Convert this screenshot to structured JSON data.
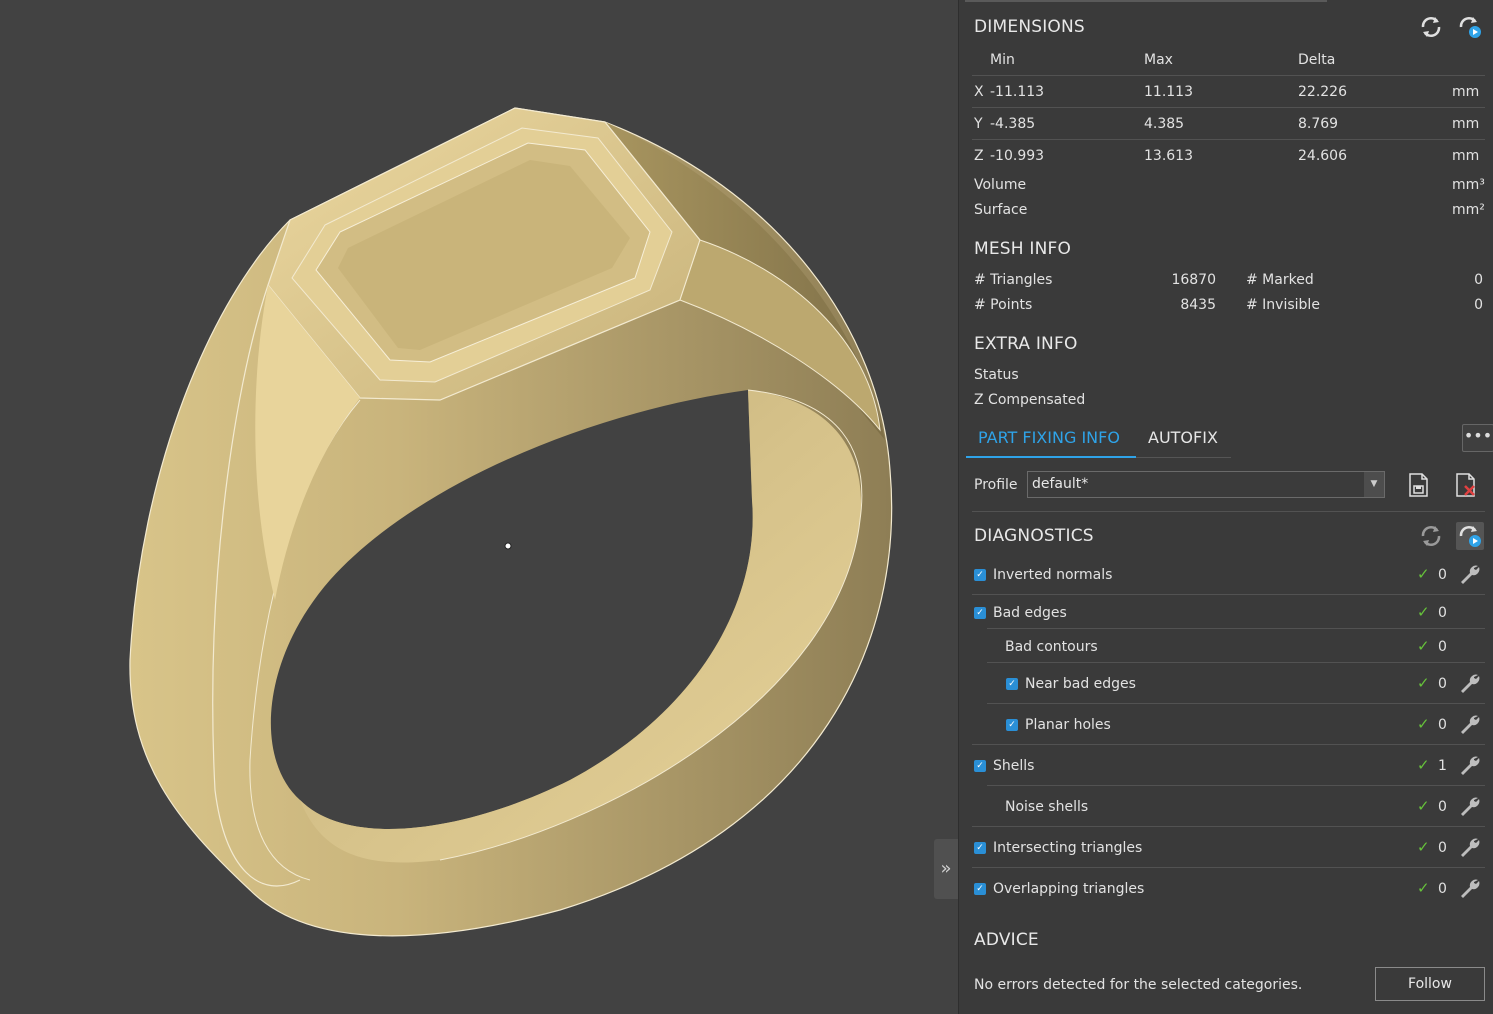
{
  "dimensions": {
    "title": "DIMENSIONS",
    "headers": {
      "min": "Min",
      "max": "Max",
      "delta": "Delta"
    },
    "rows": [
      {
        "axis": "X",
        "min": "-11.113",
        "max": "11.113",
        "delta": "22.226",
        "unit": "mm"
      },
      {
        "axis": "Y",
        "min": "-4.385",
        "max": "4.385",
        "delta": "8.769",
        "unit": "mm"
      },
      {
        "axis": "Z",
        "min": "-10.993",
        "max": "13.613",
        "delta": "24.606",
        "unit": "mm"
      }
    ],
    "volume_label": "Volume",
    "volume_unit": "mm³",
    "surface_label": "Surface",
    "surface_unit": "mm²"
  },
  "mesh_info": {
    "title": "MESH INFO",
    "triangles_label": "# Triangles",
    "triangles_value": "16870",
    "points_label": "# Points",
    "points_value": "8435",
    "marked_label": "# Marked",
    "marked_value": "0",
    "invisible_label": "# Invisible",
    "invisible_value": "0"
  },
  "extra_info": {
    "title": "EXTRA INFO",
    "status_label": "Status",
    "z_compensated_label": "Z Compensated"
  },
  "tabs": [
    {
      "label": "PART FIXING INFO",
      "active": true
    },
    {
      "label": "AUTOFIX",
      "active": false
    }
  ],
  "more_button": "•••",
  "profile": {
    "label": "Profile",
    "value": "default*"
  },
  "diagnostics": {
    "title": "DIAGNOSTICS",
    "items": [
      {
        "label": "Inverted normals",
        "count": "0",
        "checkbox": true,
        "wrench": true,
        "indent": 0
      },
      {
        "label": "Bad edges",
        "count": "0",
        "checkbox": true,
        "wrench": false,
        "indent": 0
      },
      {
        "label": "Bad contours",
        "count": "0",
        "checkbox": false,
        "wrench": false,
        "indent": 1
      },
      {
        "label": "Near bad edges",
        "count": "0",
        "checkbox": true,
        "wrench": true,
        "indent": 1
      },
      {
        "label": "Planar holes",
        "count": "0",
        "checkbox": true,
        "wrench": true,
        "indent": 1
      },
      {
        "label": "Shells",
        "count": "1",
        "checkbox": true,
        "wrench": true,
        "indent": 0
      },
      {
        "label": "Noise shells",
        "count": "0",
        "checkbox": false,
        "wrench": true,
        "indent": 1
      },
      {
        "label": "Intersecting triangles",
        "count": "0",
        "checkbox": true,
        "wrench": true,
        "indent": 0
      },
      {
        "label": "Overlapping triangles",
        "count": "0",
        "checkbox": true,
        "wrench": true,
        "indent": 0
      }
    ]
  },
  "advice": {
    "title": "ADVICE",
    "message": "No errors detected for the selected categories.",
    "follow_label": "Follow"
  },
  "viewport": {
    "collapse_glyph": "»",
    "model_color": "#d9c48c",
    "background": "#424242"
  },
  "colors": {
    "accent": "#2fa3e8",
    "ok": "#66c23a",
    "error": "#e04040"
  }
}
